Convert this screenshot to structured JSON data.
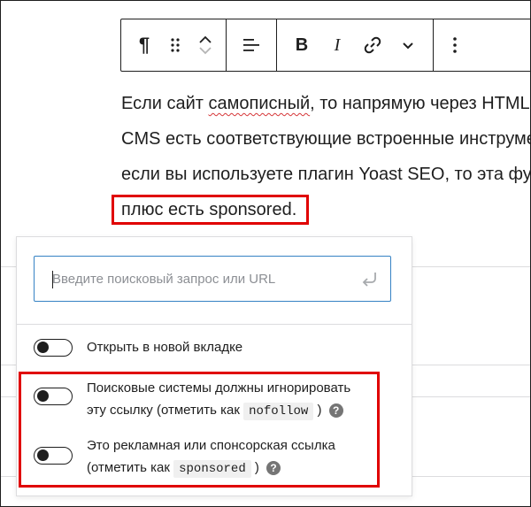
{
  "toolbar": {
    "paragraph_glyph": "¶"
  },
  "paragraph": {
    "line1_before": "Если сайт ",
    "line1_misspelled": "самописный",
    "line1_after": ", то напрямую через HTML. В",
    "line2": "CMS есть соответствующие встроенные инструменты,",
    "line3": "если вы используете плагин Yoast SEO, то эта функция",
    "line4": "плюс есть sponsored."
  },
  "link_popover": {
    "search_placeholder": "Введите поисковый запрос или URL",
    "options": [
      {
        "label": "Открыть в новой вкладке",
        "enabled": false
      },
      {
        "label_line1": "Поисковые системы должны игнорировать",
        "label_line2_before": "эту ссылку (отметить как",
        "keyword": "nofollow",
        "label_line2_after": ")",
        "enabled": false
      },
      {
        "label_line1": "Это рекламная или спонсорская ссылка",
        "label_line2_before": "(отметить как",
        "keyword": "sponsored",
        "label_line2_after": ")",
        "enabled": false
      }
    ],
    "help_glyph": "?"
  },
  "colors": {
    "highlight": "#e00000",
    "focus_border": "#3582c4",
    "text": "#1e1e1e"
  }
}
